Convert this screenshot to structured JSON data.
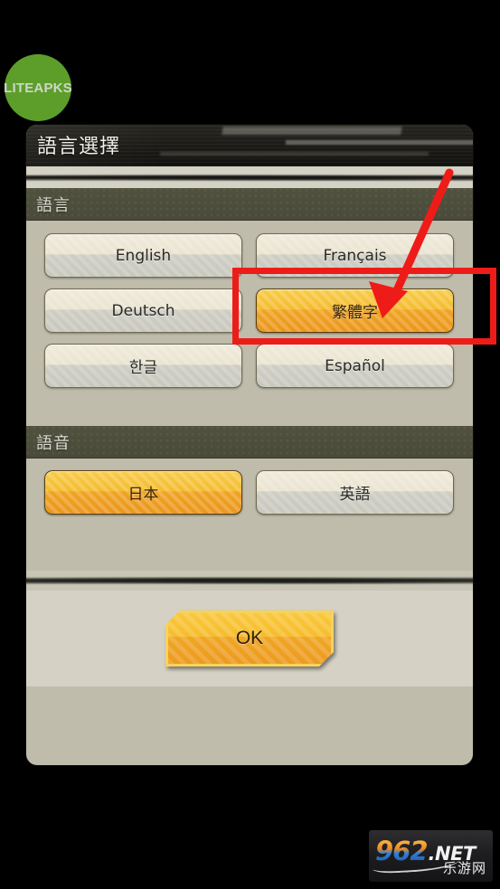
{
  "watermark_badge": {
    "label": "LITEAPKS",
    "color": "#5d9e2b"
  },
  "dialog": {
    "title": "語言選擇",
    "sections": [
      {
        "id": "language",
        "header": "語言",
        "options": [
          {
            "label": "English",
            "selected": false
          },
          {
            "label": "Français",
            "selected": false
          },
          {
            "label": "Deutsch",
            "selected": false
          },
          {
            "label": "繁體字",
            "selected": true
          },
          {
            "label": "한글",
            "selected": false
          },
          {
            "label": "Español",
            "selected": false
          }
        ]
      },
      {
        "id": "voice",
        "header": "語音",
        "options": [
          {
            "label": "日本",
            "selected": true
          },
          {
            "label": "英語",
            "selected": false
          }
        ]
      }
    ],
    "confirm_button": "OK"
  },
  "annotation": {
    "highlight_target": "繁體字",
    "color": "#ee1c18"
  },
  "site_watermark": {
    "number": "962",
    "tld": ".NET",
    "chinese": "乐游网"
  },
  "theme": {
    "panel_background": "#bfbcab",
    "section_bar": "#4a4a3a",
    "selected_button": "#f4bc30",
    "unselected_button": "#eae4d1",
    "header_band": "#1b1a16"
  }
}
